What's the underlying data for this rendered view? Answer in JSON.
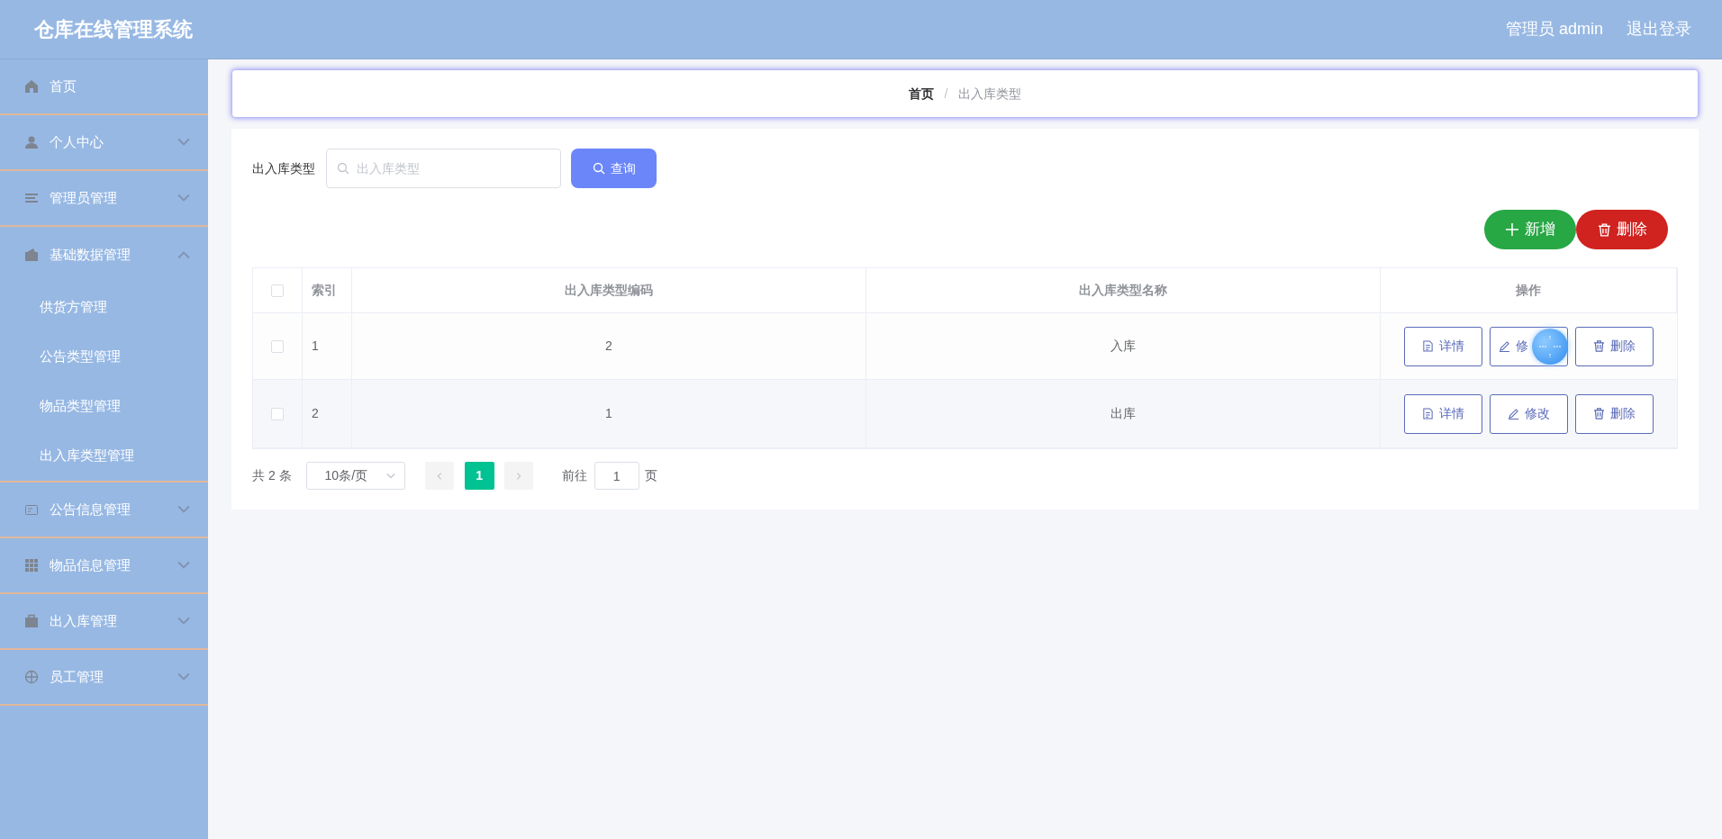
{
  "header": {
    "title": "仓库在线管理系统",
    "user": "管理员 admin",
    "logout": "退出登录"
  },
  "sidebar": {
    "items": [
      {
        "label": "首页",
        "kind": "link"
      },
      {
        "label": "个人中心",
        "kind": "submenu",
        "expanded": false
      },
      {
        "label": "管理员管理",
        "kind": "submenu",
        "expanded": false
      },
      {
        "label": "基础数据管理",
        "kind": "submenu",
        "expanded": true,
        "children": [
          {
            "label": "供货方管理"
          },
          {
            "label": "公告类型管理"
          },
          {
            "label": "物品类型管理"
          },
          {
            "label": "出入库类型管理"
          }
        ]
      },
      {
        "label": "公告信息管理",
        "kind": "submenu",
        "expanded": false
      },
      {
        "label": "物品信息管理",
        "kind": "submenu",
        "expanded": false
      },
      {
        "label": "出入库管理",
        "kind": "submenu",
        "expanded": false
      },
      {
        "label": "员工管理",
        "kind": "submenu",
        "expanded": false
      }
    ]
  },
  "breadcrumb": {
    "separator": "/",
    "items": [
      "首页",
      "出入库类型"
    ]
  },
  "search": {
    "label": "出入库类型",
    "placeholder": "出入库类型",
    "button": "查询"
  },
  "actions": {
    "add": "新增",
    "delete": "删除"
  },
  "table": {
    "all_checked": false,
    "columns": [
      "索引",
      "出入库类型编码",
      "出入库类型名称",
      "操作"
    ],
    "rows": [
      {
        "checked": false,
        "index": "1",
        "code": "2",
        "name": "入库",
        "buttons": [
          "详情",
          "修",
          "删除"
        ]
      },
      {
        "checked": false,
        "index": "2",
        "code": "1",
        "name": "出库",
        "buttons": [
          "详情",
          "修改",
          "删除"
        ]
      }
    ]
  },
  "pagination": {
    "total": "共 2 条",
    "page_size": "10条/页",
    "pages": [
      {
        "label": "1",
        "selected": true
      }
    ],
    "goto": "前往",
    "goto_value": "1",
    "page_unit": "页"
  }
}
